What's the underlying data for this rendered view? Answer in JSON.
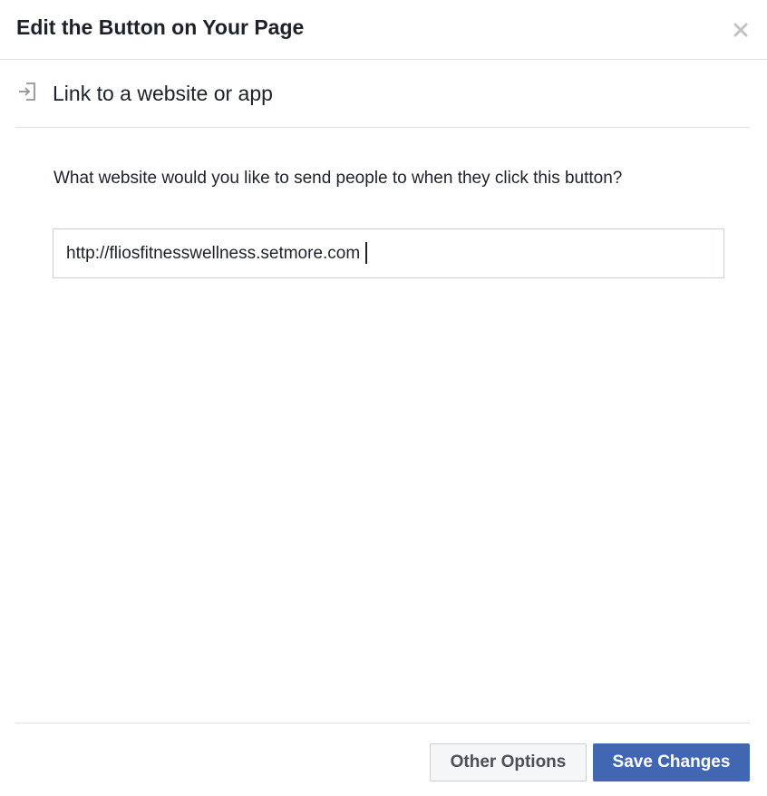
{
  "dialog": {
    "title": "Edit the Button on Your Page",
    "close_icon": "close-icon"
  },
  "section": {
    "icon": "sign-in-arrow-icon",
    "label": "Link to a website or app"
  },
  "form": {
    "question": "What website would you like to send people to when they click this button?",
    "url_value": "http://fliosfitnesswellness.setmore.com"
  },
  "footer": {
    "other_options_label": "Other Options",
    "save_label": "Save Changes"
  },
  "colors": {
    "primary": "#4267b2",
    "border": "#dddfe2",
    "text": "#1d2129"
  }
}
